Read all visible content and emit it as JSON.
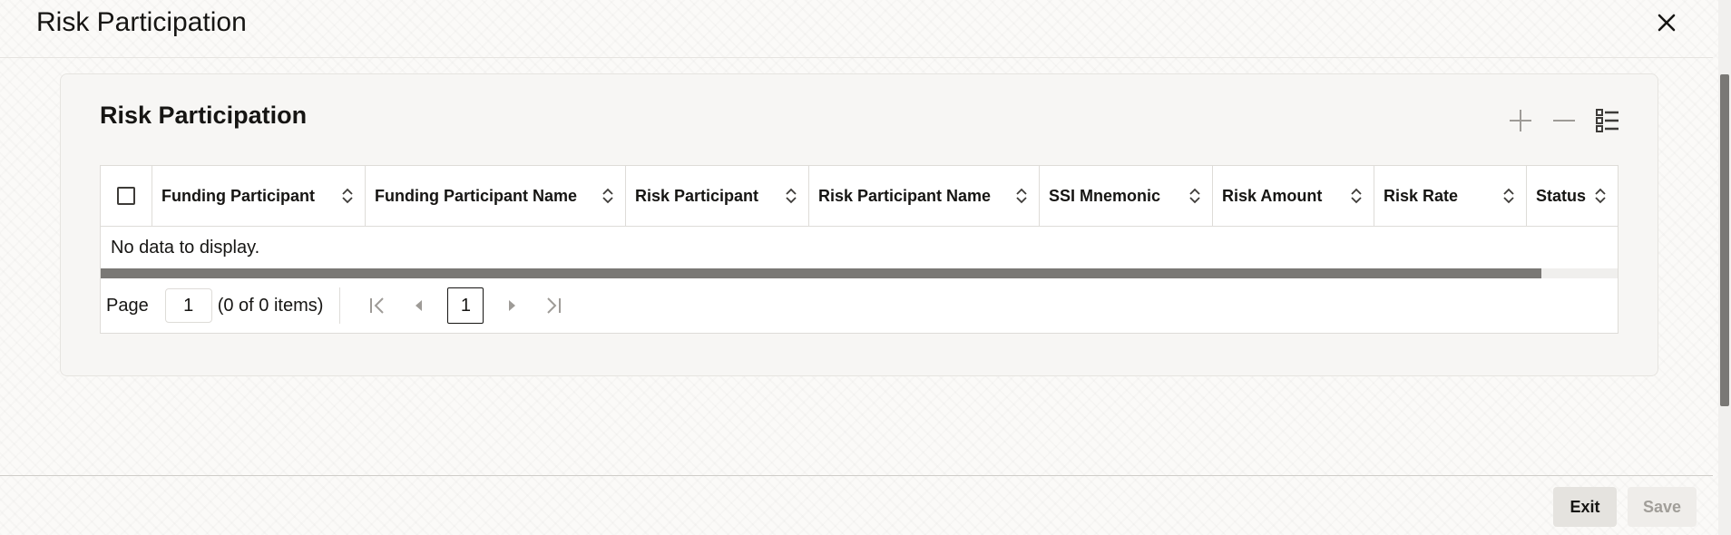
{
  "window": {
    "title": "Risk Participation"
  },
  "panel": {
    "title": "Risk Participation"
  },
  "grid": {
    "columns": [
      "Funding Participant",
      "Funding Participant Name",
      "Risk Participant",
      "Risk Participant Name",
      "SSI Mnemonic",
      "Risk Amount",
      "Risk Rate",
      "Status"
    ],
    "empty_message": "No data to display."
  },
  "pager": {
    "page_label": "Page",
    "page_value": "1",
    "items_text": "(0 of 0 items)",
    "current_page": "1"
  },
  "footer": {
    "exit_label": "Exit",
    "save_label": "Save"
  },
  "icons": {
    "close": "close-icon",
    "add": "plus-icon",
    "remove": "minus-icon",
    "columns": "column-list-icon",
    "sort": "sort-up-down-icon",
    "first": "first-page-icon",
    "previous": "previous-page-icon",
    "next": "next-page-icon",
    "last": "last-page-icon"
  }
}
